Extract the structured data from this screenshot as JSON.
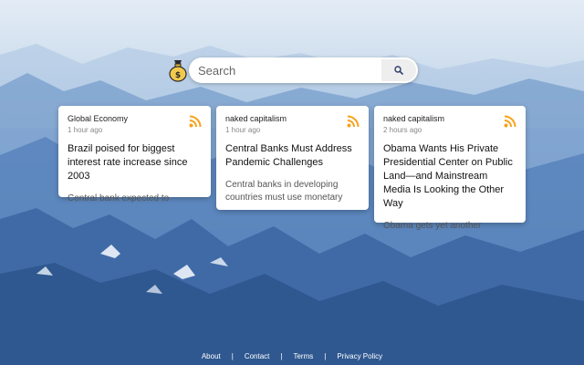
{
  "search": {
    "placeholder": "Search"
  },
  "cards": [
    {
      "source": "Global Economy",
      "time": "1 hour ago",
      "title": "Brazil poised for biggest interest rate increase since 2003",
      "snippet": "Central bank expected to"
    },
    {
      "source": "naked capitalism",
      "time": "1 hour ago",
      "title": "Central Banks Must Address Pandemic Challenges",
      "snippet": "Central banks in developing countries must use monetary"
    },
    {
      "source": "naked capitalism",
      "time": "2 hours ago",
      "title": "Obama Wants His Private Presidential Center on Public Land—and Mainstream Media Is Looking the Other Way",
      "snippet": "Obama gets yet another"
    }
  ],
  "footer": {
    "about": "About",
    "contact": "Contact",
    "terms": "Terms",
    "privacy": "Privacy Policy",
    "separator": "|"
  },
  "colors": {
    "rss": "#f7a21b",
    "sky": "#dce8f3",
    "mountain": "#2f5f9e"
  },
  "icons": {
    "logo": "money-bag-icon",
    "search": "search-icon",
    "feed": "rss-icon"
  }
}
